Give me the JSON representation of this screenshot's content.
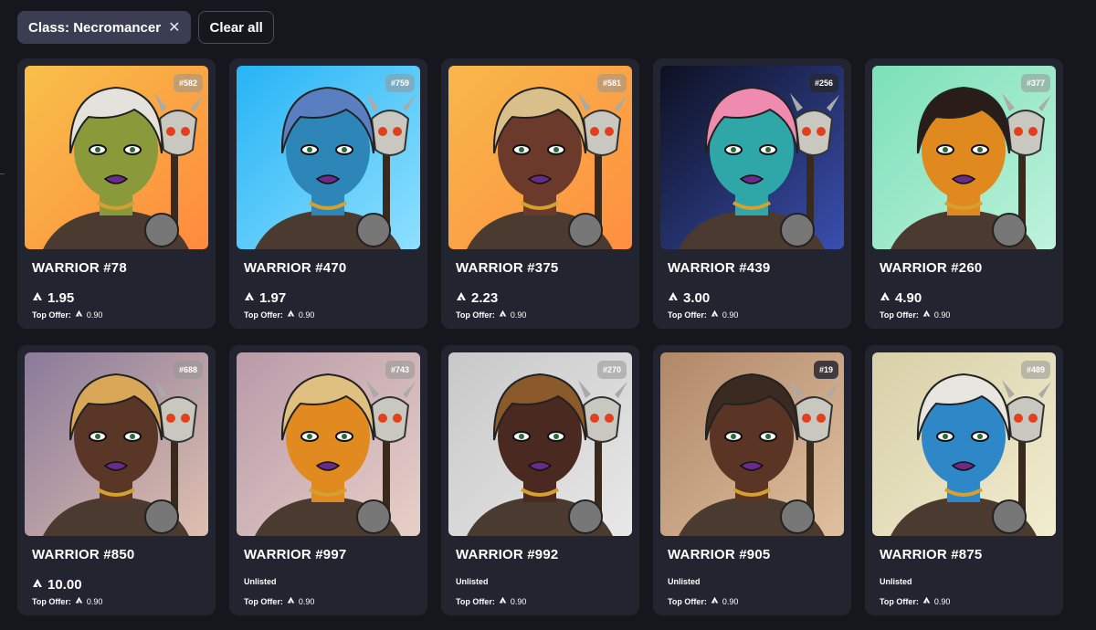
{
  "filters": {
    "active_chip_label": "Class: Necromancer",
    "remove_symbol": "✕",
    "clear_all_label": "Clear all"
  },
  "colors": {
    "background": "#16171c",
    "card": "#222430",
    "chip": "#3b3d52"
  },
  "cards": [
    {
      "tag": "#582",
      "name": "WARRIOR #78",
      "price": "1.95",
      "status": "",
      "top_offer_label": "Top Offer:",
      "top_offer": "0.90",
      "bg": [
        "#f7c04a",
        "#ff8a3d"
      ],
      "skin": "#8a9a3a",
      "hair": "#e4e2dc",
      "tag_dark": false
    },
    {
      "tag": "#759",
      "name": "WARRIOR #470",
      "price": "1.97",
      "status": "",
      "top_offer_label": "Top Offer:",
      "top_offer": "0.90",
      "bg": [
        "#27b4f5",
        "#8fe0ff"
      ],
      "skin": "#2e86b8",
      "hair": "#5a7fc0",
      "tag_dark": false
    },
    {
      "tag": "#581",
      "name": "WARRIOR #375",
      "price": "2.23",
      "status": "",
      "top_offer_label": "Top Offer:",
      "top_offer": "0.90",
      "bg": [
        "#f7b84a",
        "#ff8f40"
      ],
      "skin": "#6b3a2a",
      "hair": "#d9c08a",
      "tag_dark": false
    },
    {
      "tag": "#256",
      "name": "WARRIOR #439",
      "price": "3.00",
      "status": "",
      "top_offer_label": "Top Offer:",
      "top_offer": "0.90",
      "bg": [
        "#0d1020",
        "#3a4fb0"
      ],
      "skin": "#2fa6a8",
      "hair": "#f08bb0",
      "tag_dark": true
    },
    {
      "tag": "#377",
      "name": "WARRIOR #260",
      "price": "4.90",
      "status": "",
      "top_offer_label": "Top Offer:",
      "top_offer": "0.90",
      "bg": [
        "#7be0b8",
        "#bff2dc"
      ],
      "skin": "#e0891e",
      "hair": "#2a1c18",
      "tag_dark": false
    },
    {
      "tag": "#688",
      "name": "WARRIOR #850",
      "price": "10.00",
      "status": "",
      "top_offer_label": "Top Offer:",
      "top_offer": "0.90",
      "bg": [
        "#8a7a9a",
        "#e0c0b0"
      ],
      "skin": "#5a3626",
      "hair": "#d8a858",
      "tag_dark": false
    },
    {
      "tag": "#743",
      "name": "WARRIOR #997",
      "price": "",
      "status": "Unlisted",
      "top_offer_label": "Top Offer:",
      "top_offer": "0.90",
      "bg": [
        "#b89aa8",
        "#e8d0c8"
      ],
      "skin": "#e08a20",
      "hair": "#e0c080",
      "tag_dark": false
    },
    {
      "tag": "#270",
      "name": "WARRIOR #992",
      "price": "",
      "status": "Unlisted",
      "top_offer_label": "Top Offer:",
      "top_offer": "0.90",
      "bg": [
        "#c8c8c8",
        "#e8e8e8"
      ],
      "skin": "#4a2a20",
      "hair": "#8a5a2a",
      "tag_dark": false
    },
    {
      "tag": "#19",
      "name": "WARRIOR #905",
      "price": "",
      "status": "Unlisted",
      "top_offer_label": "Top Offer:",
      "top_offer": "0.90",
      "bg": [
        "#b08868",
        "#e0c0a0"
      ],
      "skin": "#5a3424",
      "hair": "#3a2a20",
      "tag_dark": true
    },
    {
      "tag": "#489",
      "name": "WARRIOR #875",
      "price": "",
      "status": "Unlisted",
      "top_offer_label": "Top Offer:",
      "top_offer": "0.90",
      "bg": [
        "#d8d0a8",
        "#f2ecd0"
      ],
      "skin": "#2e88c8",
      "hair": "#e8e6e0",
      "tag_dark": false
    }
  ]
}
